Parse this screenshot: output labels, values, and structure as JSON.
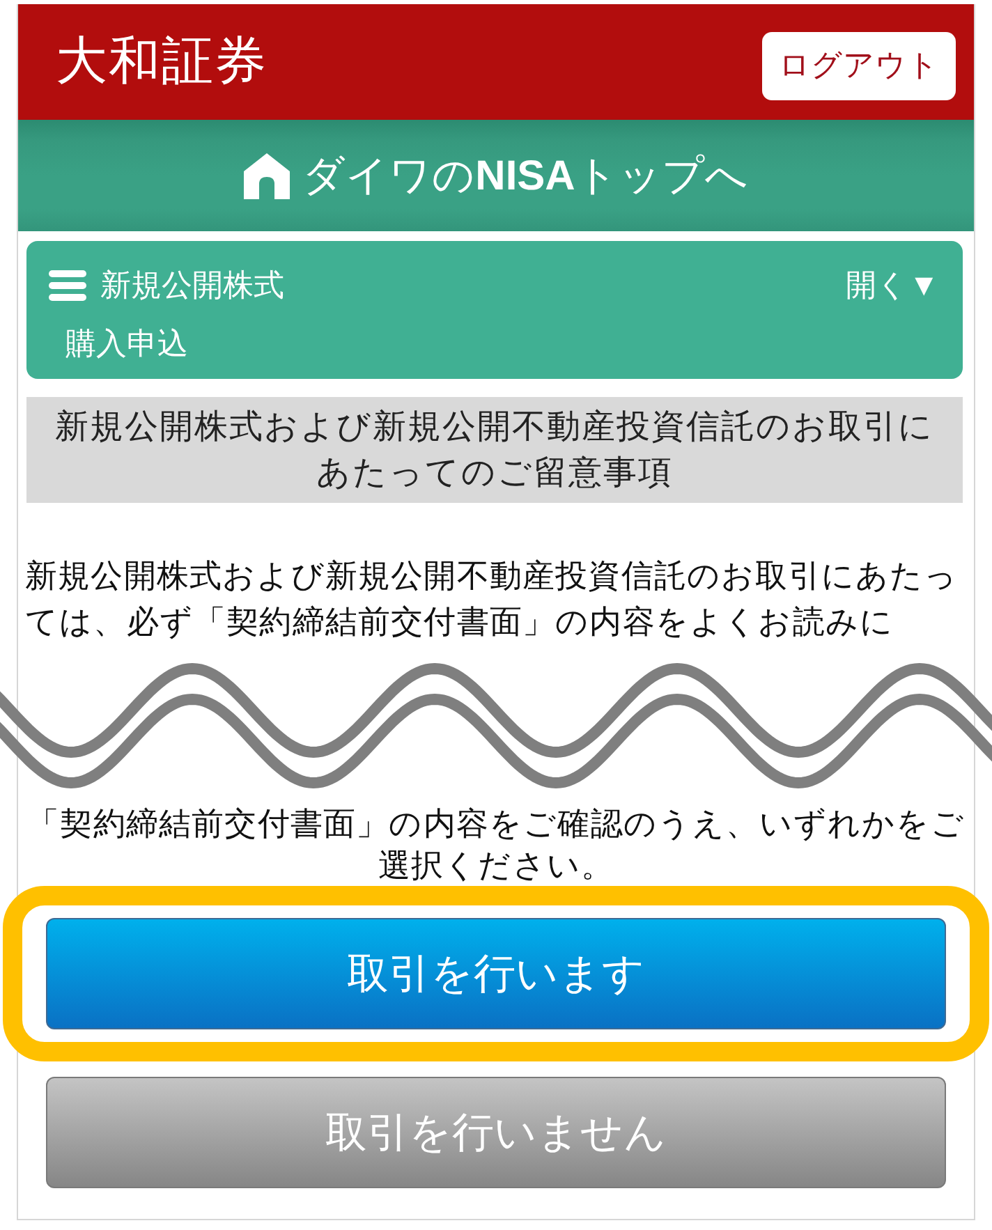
{
  "header": {
    "logo": "大和証券",
    "logout_button": "ログアウト"
  },
  "nav_bar": {
    "link": "ダイワの**NISA**トップへ"
  },
  "menu_panel": {
    "title": "新規公開株式",
    "toggle": "開く▼",
    "subtitle": "購入申込"
  },
  "notice": {
    "heading": "新規公開株式および新規公開不動産投資信託のお取引にあたってのご留意事項",
    "body": "新規公開株式および新規公開不動産投資信託のお取引にあたっては、必ず「契約締結前交付書面」の内容をよくお読みに"
  },
  "confirmation": {
    "prompt": "「契約締結前交付書面」の内容をご確認のうえ、いずれかをご選択ください。",
    "buttons": [
      {
        "label": "取引を行います",
        "kind": "primary",
        "highlighted": true
      },
      {
        "label": "取引を行いません",
        "kind": "secondary",
        "highlighted": false
      }
    ]
  }
}
